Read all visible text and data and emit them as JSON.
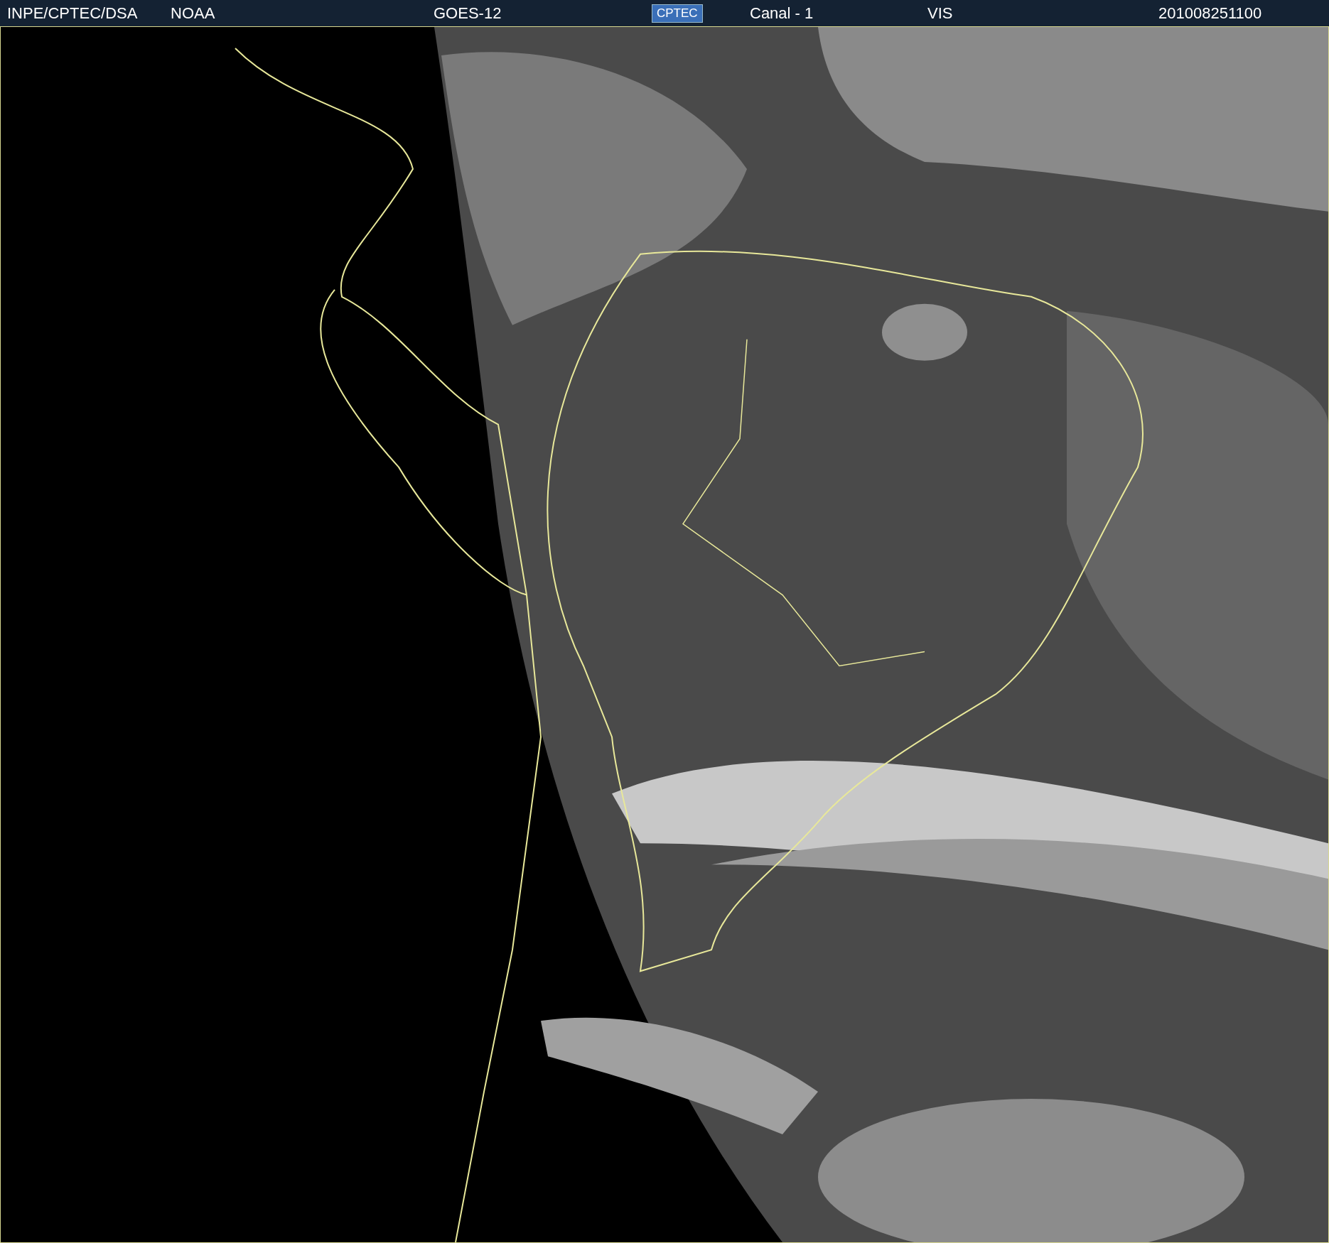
{
  "header": {
    "items": [
      {
        "kind": "text",
        "text": "INPE/CPTEC/DSA"
      },
      {
        "kind": "text",
        "text": "NOAA"
      },
      {
        "kind": "text",
        "text": "GOES-12"
      },
      {
        "kind": "logo",
        "text": "CPTEC"
      },
      {
        "kind": "text",
        "text": "Canal - 1"
      },
      {
        "kind": "text",
        "text": "VIS"
      },
      {
        "kind": "text",
        "text": "201008251100"
      }
    ]
  }
}
